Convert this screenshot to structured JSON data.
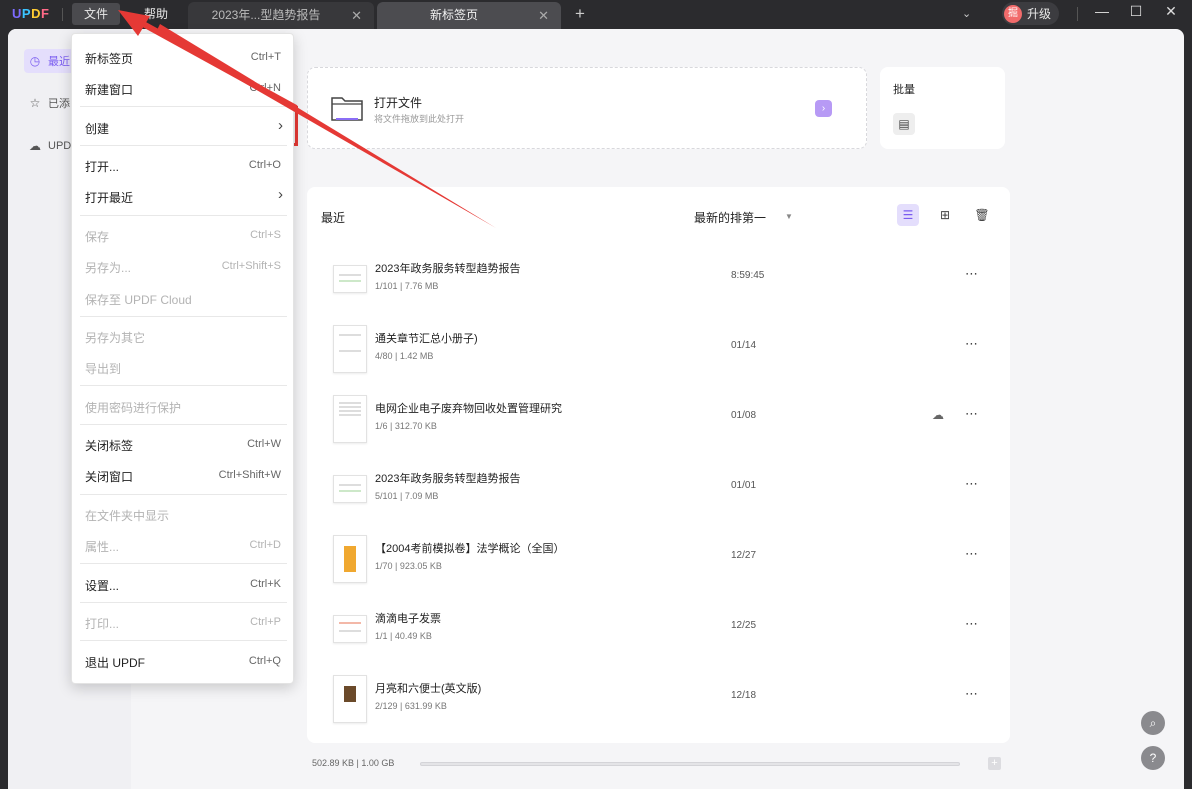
{
  "titlebar": {
    "logo": {
      "u": "U",
      "p": "P",
      "d": "D",
      "f": "F"
    },
    "menu": {
      "file": "文件",
      "help": "帮助"
    },
    "tabs": [
      {
        "label": "2023年...型趋势报告",
        "close": "✕"
      },
      {
        "label": "新标签页",
        "close": "✕"
      }
    ],
    "add_tab": "+",
    "dropdown_chevron": "⌄",
    "upgrade": {
      "avatar": "掘",
      "label": "升级"
    },
    "window_controls": {
      "minimize": "—",
      "maximize": "☐",
      "close": "✕"
    }
  },
  "sidebar": {
    "items": [
      {
        "icon": "clock-icon",
        "glyph": "◷",
        "label": "最近",
        "active": true
      },
      {
        "icon": "star-icon",
        "glyph": "☆",
        "label": "已添",
        "active": false
      },
      {
        "icon": "cloud-icon",
        "glyph": "☁",
        "label": "UPD",
        "active": false
      }
    ]
  },
  "open_card": {
    "title": "打开文件",
    "subtitle": "将文件拖放到此处打开",
    "go": "›"
  },
  "batch_card": {
    "title": "批量",
    "icon_glyph": "▤"
  },
  "recent": {
    "title": "最近",
    "sort": "最新的排第一",
    "sort_caret": "▼",
    "view_list_glyph": "☰",
    "view_grid_glyph": "⊞",
    "delete_glyph": "🗑",
    "files": [
      {
        "name": "2023年政务服务转型趋势报告",
        "meta": "1/101 | 7.76 MB",
        "time": "8:59:45",
        "cloud": ""
      },
      {
        "name": "通关章节汇总小册子)",
        "meta": "4/80 | 1.42 MB",
        "time": "01/14",
        "cloud": ""
      },
      {
        "name": "电网企业电子废弃物回收处置管理研究",
        "meta": "1/6 | 312.70 KB",
        "time": "01/08",
        "cloud": "☁"
      },
      {
        "name": "2023年政务服务转型趋势报告",
        "meta": "5/101 | 7.09 MB",
        "time": "01/01",
        "cloud": ""
      },
      {
        "name": "【2004考前模拟卷】法学概论（全国）",
        "meta": "1/70 | 923.05 KB",
        "time": "12/27",
        "cloud": ""
      },
      {
        "name": "滴滴电子发票",
        "meta": "1/1 | 40.49 KB",
        "time": "12/25",
        "cloud": ""
      },
      {
        "name": "月亮和六便士(英文版)",
        "meta": "2/129 | 631.99 KB",
        "time": "12/18",
        "cloud": ""
      }
    ],
    "more_glyph": "⋯"
  },
  "footer": {
    "usage": "502.89 KB | 1.00 GB",
    "usage_fraction": 0.0005,
    "add_glyph": "+"
  },
  "float_buttons": {
    "search": "⌕",
    "help": "?"
  },
  "dropdown": {
    "items": [
      {
        "label": "新标签页",
        "shortcut": "Ctrl+T",
        "disabled": false
      },
      {
        "label": "新建窗口",
        "shortcut": "Ctrl+N",
        "disabled": false
      },
      {
        "label": "创建",
        "shortcut": "",
        "submenu": true,
        "disabled": false
      },
      {
        "label": "打开...",
        "shortcut": "Ctrl+O",
        "disabled": false
      },
      {
        "label": "打开最近",
        "shortcut": "",
        "submenu": true,
        "disabled": false
      },
      {
        "label": "保存",
        "shortcut": "Ctrl+S",
        "disabled": true
      },
      {
        "label": "另存为...",
        "shortcut": "Ctrl+Shift+S",
        "disabled": true
      },
      {
        "label": "保存至 UPDF Cloud",
        "shortcut": "",
        "disabled": true
      },
      {
        "label": "另存为其它",
        "shortcut": "",
        "disabled": true
      },
      {
        "label": "导出到",
        "shortcut": "",
        "disabled": true
      },
      {
        "label": "使用密码进行保护",
        "shortcut": "",
        "disabled": true
      },
      {
        "label": "关闭标签",
        "shortcut": "Ctrl+W",
        "disabled": false
      },
      {
        "label": "关闭窗口",
        "shortcut": "Ctrl+Shift+W",
        "disabled": false
      },
      {
        "label": "在文件夹中显示",
        "shortcut": "",
        "disabled": true
      },
      {
        "label": "属性...",
        "shortcut": "Ctrl+D",
        "disabled": true
      },
      {
        "label": "设置...",
        "shortcut": "Ctrl+K",
        "disabled": false
      },
      {
        "label": "打印...",
        "shortcut": "Ctrl+P",
        "disabled": true
      },
      {
        "label": "退出 UPDF",
        "shortcut": "Ctrl+Q",
        "disabled": false
      }
    ],
    "submenu_arrow": "›"
  },
  "colors": {
    "accent": "#7a5cf0",
    "annotation": "#e53935"
  }
}
